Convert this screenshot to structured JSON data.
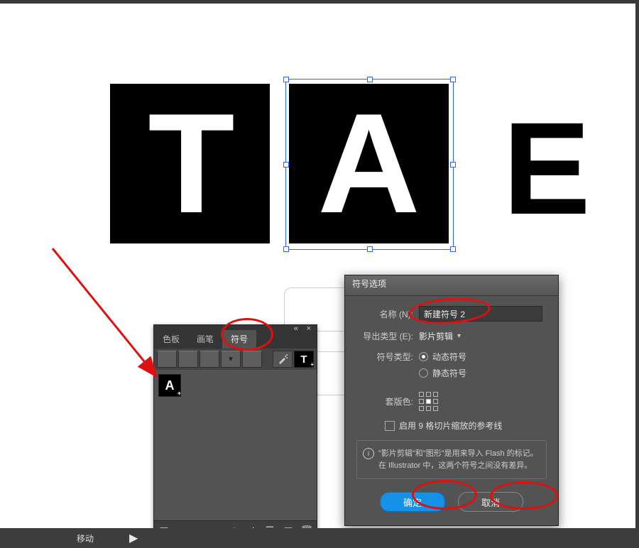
{
  "status_bar": {
    "text": "移动",
    "arrow": "▶"
  },
  "artwork": {
    "t": "T",
    "a": "A",
    "e": "E"
  },
  "panel": {
    "tabs": {
      "color": "色板",
      "brush": "画笔",
      "symbol": "符号"
    },
    "sample_letter": "T",
    "symbol_letter": "A"
  },
  "dialog": {
    "title": "符号选项",
    "name_label": "名称 (N):",
    "name_value": "新建符号 2",
    "export_label": "导出类型 (E):",
    "export_value": "影片剪辑",
    "type_label": "符号类型:",
    "type_dynamic": "动态符号",
    "type_static": "静态符号",
    "reg_label": "套版色:",
    "nine_slice": "启用 9 格切片缩放的参考线",
    "info": "\"影片剪辑\"和\"图形\"是用来导入 Flash 的标记。在 Illustrator 中，这两个符号之间没有差异。",
    "ok": "确定",
    "cancel": "取消"
  }
}
